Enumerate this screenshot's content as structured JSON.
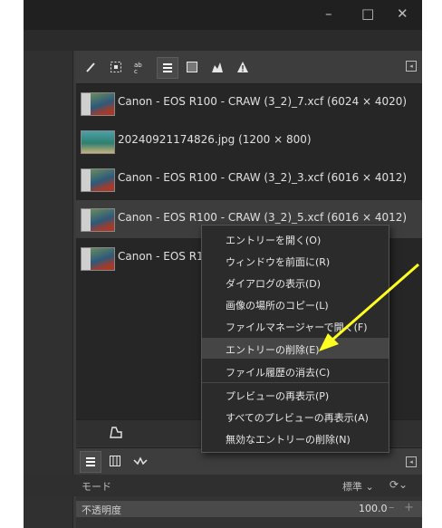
{
  "window_controls": {
    "minimize": "–",
    "maximize": "□",
    "close": "✕"
  },
  "tabs": {
    "brush": "brush-icon",
    "pattern": "pattern-icon",
    "font": "font-icon",
    "history": "document-history-icon",
    "image": "images-icon",
    "histogram": "histogram-icon",
    "warning": "error-console-icon"
  },
  "documents": [
    {
      "name": "Canon - EOS R100 - CRAW (3_2)_7.xcf (6024 × 4020)"
    },
    {
      "name": "20240921174826.jpg (1200 × 800)"
    },
    {
      "name": "Canon - EOS R100 - CRAW (3_2)_3.xcf (6016 × 4012)"
    },
    {
      "name": "Canon - EOS R100 - CRAW (3_2)_5.xcf (6016 × 4012)"
    },
    {
      "name": "Canon - EOS R1"
    }
  ],
  "context_menu": [
    {
      "label": "エントリーを開く(O)"
    },
    {
      "label": "ウィンドウを前面に(R)"
    },
    {
      "label": "ダイアログの表示(D)"
    },
    {
      "label": "画像の場所のコピー(L)"
    },
    {
      "label": "ファイルマネージャーで開く(F)"
    },
    {
      "label": "エントリーの削除(E)"
    },
    {
      "label": "ファイル履歴の消去(C)"
    },
    {
      "label": "プレビューの再表示(P)"
    },
    {
      "label": "すべてのプレビューの再表示(A)"
    },
    {
      "label": "無効なエントリーの削除(N)"
    }
  ],
  "layers": {
    "mode_label": "モード",
    "mode_value": "標準 ⌄",
    "opacity_label": "不透明度",
    "opacity_value": "100.0"
  },
  "colors": {
    "annotation_arrow": "#ffff22",
    "highlight": "#454545"
  }
}
